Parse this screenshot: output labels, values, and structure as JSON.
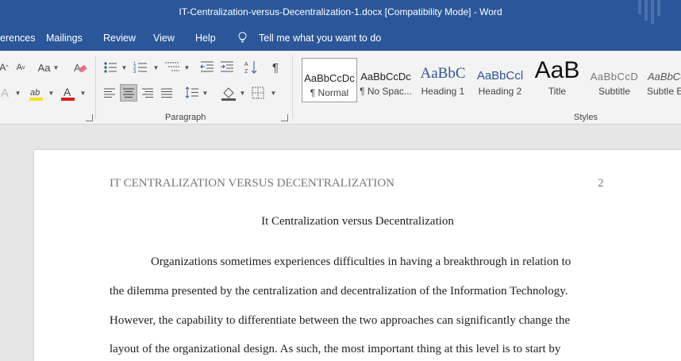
{
  "window": {
    "title": "IT-Centralization-versus-Decentralization-1.docx [Compatibility Mode]  -  Word"
  },
  "menu": {
    "tabs": [
      "erences",
      "Mailings",
      "Review",
      "View",
      "Help"
    ],
    "tell_me": "Tell me what you want to do"
  },
  "ribbon": {
    "paragraph_label": "Paragraph",
    "styles_label": "Styles",
    "font_aa": "Aa",
    "styles": [
      {
        "preview": "AaBbCcDc",
        "label": "¶ Normal"
      },
      {
        "preview": "AaBbCcDc",
        "label": "¶ No Spac..."
      },
      {
        "preview": "AaBbC",
        "label": "Heading 1"
      },
      {
        "preview": "AaBbCcl",
        "label": "Heading 2"
      },
      {
        "preview": "AaB",
        "label": "Title"
      },
      {
        "preview": "AaBbCcD",
        "label": "Subtitle"
      },
      {
        "preview": "AaBbCcl",
        "label": "Subtle E"
      }
    ]
  },
  "document": {
    "header_text": "IT CENTRALIZATION VERSUS DECENTRALIZATION",
    "page_number": "2",
    "title": "It Centralization versus Decentralization",
    "lines": [
      "Organizations sometimes experiences difficulties in having a breakthrough in relation to",
      "the dilemma presented by the centralization and decentralization of the Information Technology.",
      "However, the capability to differentiate between the two approaches can significantly change the",
      "layout of the organizational design. As such, the most important thing at this level is to start by"
    ]
  }
}
